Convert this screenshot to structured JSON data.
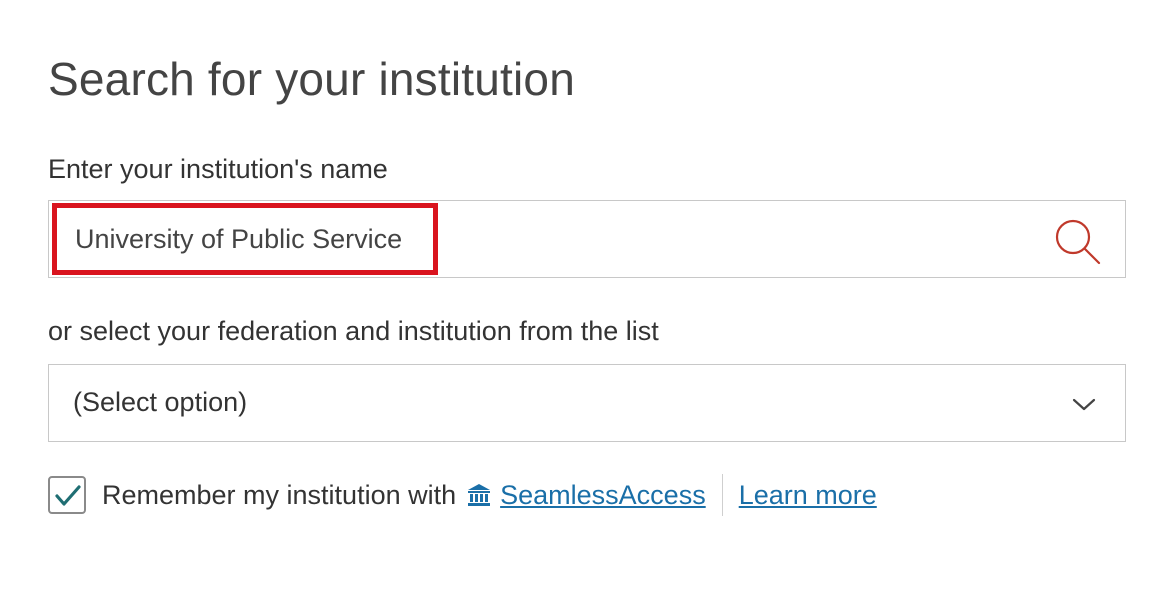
{
  "page": {
    "title": "Search for your institution"
  },
  "search": {
    "label": "Enter your institution's name",
    "value": "University of Public Service",
    "button_icon": "search-icon"
  },
  "federation_select": {
    "label": "or select your federation and institution from the list",
    "selected": "(Select option)",
    "icon": "chevron-down-icon"
  },
  "remember": {
    "checked": true,
    "text": "Remember my institution with",
    "provider_icon": "institution-icon",
    "provider_link": "SeamlessAccess",
    "learn_more_link": "Learn more"
  },
  "colors": {
    "highlight": "#d9141e",
    "link": "#1a6fa8",
    "check": "#1f6e73",
    "search_icon": "#c0392b"
  }
}
